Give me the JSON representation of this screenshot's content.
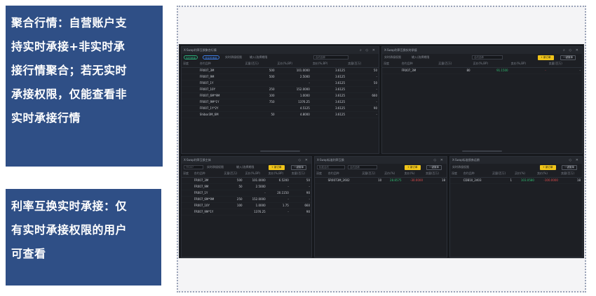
{
  "callouts": {
    "aggregated": {
      "lines": [
        "聚合行情：自营账户支",
        "持实时承接+非实时承",
        "接行情聚合；若无实时",
        "承接权限，仅能查看非",
        "实时承接行情"
      ]
    },
    "irs": {
      "lines": [
        "利率互换实时承接：仅",
        "有实时承接权限的用户",
        "可查看"
      ]
    }
  },
  "colors": {
    "accent": "#2f4f86",
    "bid_green": "#2fbf71",
    "ask_red": "#e24b4b",
    "button_yellow": "#f0c419"
  },
  "panel1": {
    "title": "X-Swap利率互换聚合行情",
    "controls": "⌕ ◇ ✕",
    "tags": [
      "实时承接",
      "非实时承接"
    ],
    "toolbar_label": "实时承接权限",
    "filter_label": "输入/选择期限",
    "search_placeholder": "合约品种",
    "columns": [
      "深度",
      "合约品种",
      "买量(百万)",
      "买价(%,BP)",
      "卖价(%,BP)",
      "卖量(百万)"
    ],
    "rows": [
      [
        "",
        "FR007_3M",
        "500",
        "101.0000",
        "3.6125",
        "50"
      ],
      [
        "",
        "FR007_9M",
        "500",
        "2.5000",
        "3.6125",
        "-"
      ],
      [
        "",
        "FR007_1Y",
        "",
        "-",
        "3.6125",
        "50"
      ],
      [
        "",
        "FR007_10Y",
        "250",
        "152.0000",
        "3.6125",
        "-"
      ],
      [
        "",
        "FR007_6M*9M",
        "100",
        "1.0000",
        "3.6125",
        "660"
      ],
      [
        "",
        "FR007_9M*1Y",
        "750",
        "1376.25",
        "3.6125",
        "-"
      ],
      [
        "",
        "FR007_1Y*2Y",
        "",
        "4.5125",
        "3.6125",
        "90"
      ],
      [
        "",
        "Shibor3M_6M",
        "50",
        "4.8000",
        "3.6125",
        "-"
      ]
    ]
  },
  "panel2": {
    "title": "X-Swap利率互换实时承接",
    "controls": "⌕ ◇ ✕",
    "toolbar_label": "实时承接权限",
    "filter_label": "输入/选择期限",
    "search_placeholder": "合约品种",
    "add_label": "+ 新订单",
    "cancel_label": "一键撤单",
    "columns": [
      "深度",
      "合约品种",
      "买量(百万)",
      "买价(%,BP)",
      "卖价(%,BP)",
      "卖量(百万)"
    ],
    "rows": [
      [
        "",
        "FR007_3M",
        "80",
        "91.1500",
        "-",
        "-"
      ]
    ]
  },
  "panel3": {
    "title": "X-Swap利率互换主体",
    "controls": "◇ ✕",
    "dropdown": "FR007",
    "toolbar_label": "实时承接权限",
    "filter_label": "输入/选择期限",
    "add_label": "+ 新订单",
    "cancel_label": "一键撤单",
    "columns": [
      "深度",
      "合约品种",
      "买量(百万)",
      "买价(%,BP)",
      "卖价(%,BP)",
      "卖量(百万)"
    ],
    "rows": [
      [
        "",
        "FR007_3M",
        "500",
        "101.0000",
        "6.5200",
        "50"
      ],
      [
        "",
        "FR007_9M",
        "50",
        "2.5000",
        "-",
        "-"
      ],
      [
        "",
        "FR007_1Y",
        "",
        "-",
        "20.1150",
        "90"
      ],
      [
        "",
        "FR007_6M*9M",
        "250",
        "152.0000",
        "-",
        "-"
      ],
      [
        "",
        "FR007_10Y",
        "100",
        "1.0000",
        "1.75",
        "660"
      ],
      [
        "",
        "FR007_9M*1Y",
        "",
        "1376.25",
        "-",
        "90"
      ]
    ]
  },
  "panel4": {
    "title": "X-Swap标准利率互换",
    "controls": "◇ ✕",
    "dropdown": "标准合约",
    "search_placeholder": "合约品种",
    "add_label": "+ 新订单",
    "cancel_label": "一键撤单",
    "columns": [
      "深度",
      "合约品种",
      "买量(百万)",
      "买价(%)",
      "卖价(%)",
      "卖量(百万)"
    ],
    "rows": [
      [
        "",
        "SR0073M_2602",
        "10",
        "28.8575",
        "-30.0000",
        "18"
      ]
    ]
  },
  "panel5": {
    "title": "X-Swap标准债券远期",
    "controls": "◇ ✕",
    "toolbar_label": "实时承接权限",
    "add_label": "+ 新订单",
    "cancel_label": "一键撤单",
    "columns": [
      "深度",
      "合约品种",
      "买量(百万)",
      "买价(%)",
      "卖价(%)",
      "卖量(百万)"
    ],
    "rows": [
      [
        "",
        "CDB10_2403",
        "1",
        "103.0580",
        "-100.0000",
        "18"
      ]
    ]
  }
}
